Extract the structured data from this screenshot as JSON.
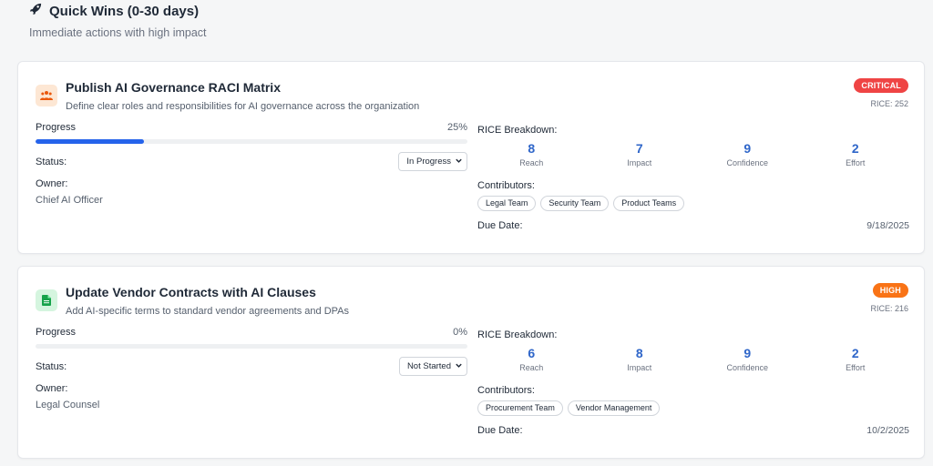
{
  "section": {
    "title": "Quick Wins (0-30 days)",
    "subtitle": "Immediate actions with high impact",
    "icon": "rocket-icon"
  },
  "labels": {
    "progress": "Progress",
    "status": "Status:",
    "owner": "Owner:",
    "rice_breakdown": "RICE Breakdown:",
    "reach": "Reach",
    "impact": "Impact",
    "confidence": "Confidence",
    "effort": "Effort",
    "contributors": "Contributors:",
    "due_date": "Due Date:"
  },
  "cards": [
    {
      "icon": "team-icon",
      "icon_color": "#f97316",
      "title": "Publish AI Governance RACI Matrix",
      "description": "Define clear roles and responsibilities for AI governance across the organization",
      "priority": "CRITICAL",
      "priority_color": "#ef4444",
      "rice": "RICE: 252",
      "progress": 25,
      "progress_label": "25%",
      "status": "In Progress",
      "owner": "Chief AI Officer",
      "reach": "8",
      "impact": "7",
      "confidence": "9",
      "effort": "2",
      "contributors": [
        "Legal Team",
        "Security Team",
        "Product Teams"
      ],
      "due_date": "9/18/2025"
    },
    {
      "icon": "document-icon",
      "icon_color": "#16a34a",
      "title": "Update Vendor Contracts with AI Clauses",
      "description": "Add AI-specific terms to standard vendor agreements and DPAs",
      "priority": "HIGH",
      "priority_color": "#f97316",
      "rice": "RICE: 216",
      "progress": 0,
      "progress_label": "0%",
      "status": "Not Started",
      "owner": "Legal Counsel",
      "reach": "6",
      "impact": "8",
      "confidence": "9",
      "effort": "2",
      "contributors": [
        "Procurement Team",
        "Vendor Management"
      ],
      "due_date": "10/2/2025"
    }
  ]
}
